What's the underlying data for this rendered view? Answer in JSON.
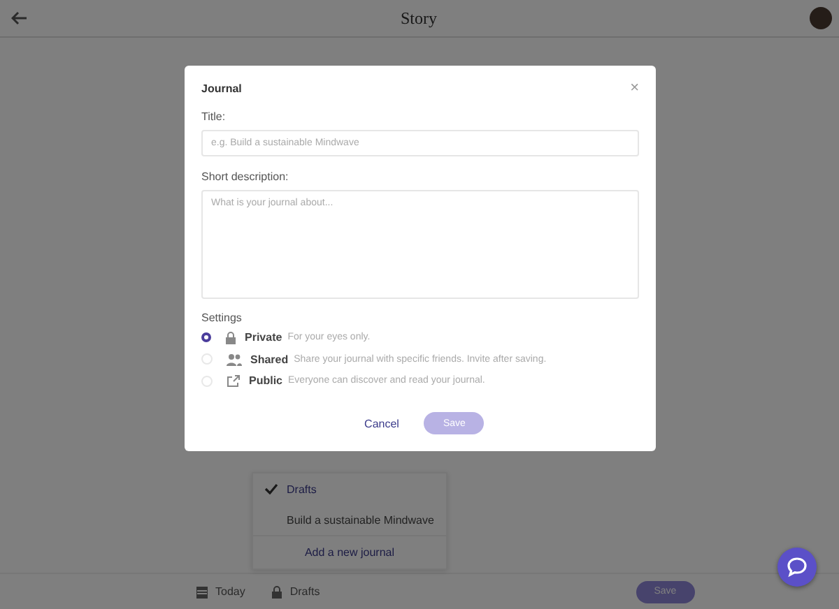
{
  "header": {
    "title": "Story"
  },
  "dropdown": {
    "items": [
      {
        "label": "Drafts",
        "selected": true
      },
      {
        "label": "Build a sustainable Mindwave",
        "selected": false
      }
    ],
    "add_label": "Add a new journal"
  },
  "bottom_bar": {
    "date": "Today",
    "journal": "Drafts",
    "save": "Save"
  },
  "dialog": {
    "title": "Journal",
    "close": "×",
    "title_label": "Title:",
    "title_placeholder": "e.g. Build a sustainable Mindwave",
    "description_label": "Short description:",
    "description_placeholder": "What is your journal about...",
    "settings_label": "Settings",
    "options": [
      {
        "kind": "lock",
        "label": "Private",
        "hint": "For your eyes only.",
        "selected": true
      },
      {
        "kind": "people",
        "label": "Shared",
        "hint": "Share your journal with specific friends. Invite after saving.",
        "selected": false
      },
      {
        "kind": "share",
        "label": "Public",
        "hint": "Everyone can discover and read your journal.",
        "selected": false
      }
    ],
    "cancel": "Cancel",
    "save": "Save"
  }
}
